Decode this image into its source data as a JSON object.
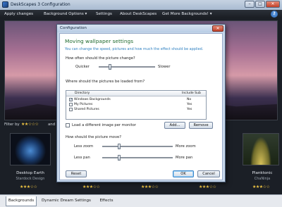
{
  "window": {
    "title": "DeskScapes 3 Configuration",
    "buttons": [
      "–",
      "□",
      "✕"
    ]
  },
  "menubar": {
    "items": [
      "Apply changes",
      "Background Options ▾",
      "Settings",
      "About DeskScapes",
      "Get More Backgrounds! ▾"
    ],
    "help": "?"
  },
  "filter": {
    "label": "Filter by",
    "stars": "★★☆☆☆",
    "partial": "and"
  },
  "thumbnails": [
    {
      "title": "Desktop Earth",
      "author": "Stardock Design",
      "rating": "★★★☆☆"
    },
    {
      "title": "Planktonic",
      "author": "ChaNinja",
      "rating": "★★★☆☆"
    }
  ],
  "ratings_row": [
    "★★★☆☆",
    "★★★☆☆",
    "★★★☆☆",
    "★★★☆☆",
    "★★★☆☆"
  ],
  "tabs": [
    "Backgrounds",
    "Dynamic Dream Settings",
    "Effects"
  ],
  "dialog": {
    "title": "Configuration",
    "close": "✕",
    "heading": "Moving wallpaper settings",
    "subtitle": "You can change the speed, pictures and how much the effect should be applied.",
    "q_change": "How often should the picture change?",
    "quicker": "Quicker",
    "slower": "Slower",
    "q_loaded": "Where should the pictures be loaded from?",
    "table": {
      "headers": [
        "Directory",
        "Include Sub"
      ],
      "rows": [
        {
          "checked": "✓",
          "directory": "Windows Backgrounds",
          "include": "No"
        },
        {
          "checked": "",
          "directory": "My Pictures",
          "include": "Yes"
        },
        {
          "checked": "",
          "directory": "Shared Pictures",
          "include": "Yes"
        }
      ]
    },
    "load_different": "Load a different image per monitor",
    "add_button": "Add...",
    "remove_button": "Remove",
    "q_move": "How should the picture move?",
    "less_zoom": "Less zoom",
    "more_zoom": "More zoom",
    "less_pan": "Less pan",
    "more_pan": "More pan",
    "reset_button": "Reset",
    "ok_button": "OK",
    "cancel_button": "Cancel"
  }
}
